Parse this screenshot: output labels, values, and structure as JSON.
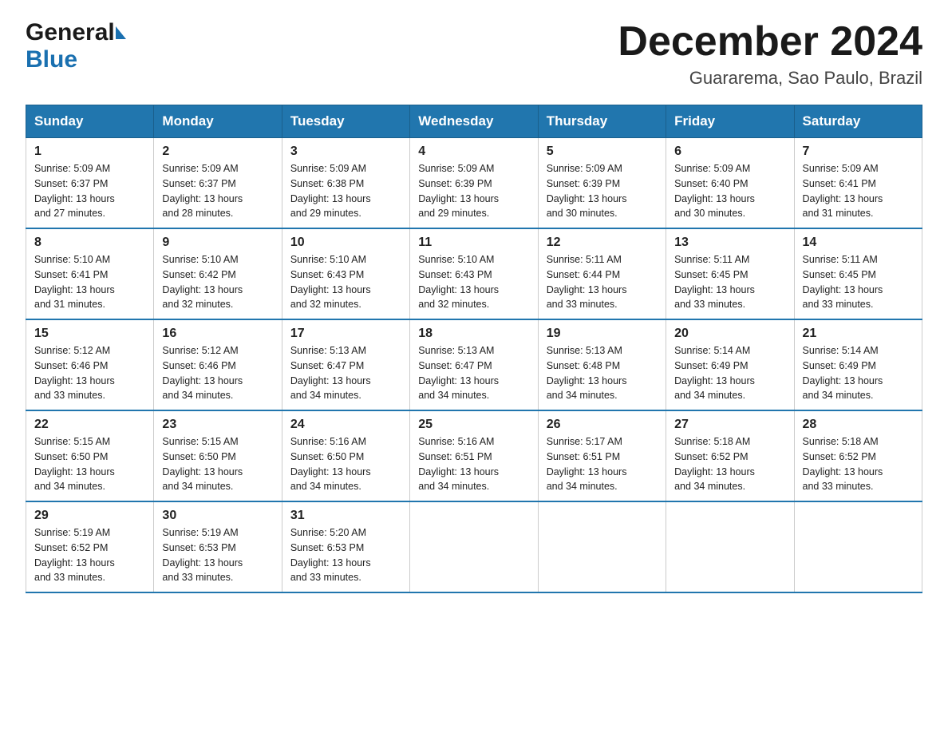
{
  "logo": {
    "general": "General",
    "blue": "Blue"
  },
  "title": "December 2024",
  "location": "Guararema, Sao Paulo, Brazil",
  "days_of_week": [
    "Sunday",
    "Monday",
    "Tuesday",
    "Wednesday",
    "Thursday",
    "Friday",
    "Saturday"
  ],
  "weeks": [
    [
      {
        "day": "1",
        "sunrise": "5:09 AM",
        "sunset": "6:37 PM",
        "daylight": "13 hours and 27 minutes."
      },
      {
        "day": "2",
        "sunrise": "5:09 AM",
        "sunset": "6:37 PM",
        "daylight": "13 hours and 28 minutes."
      },
      {
        "day": "3",
        "sunrise": "5:09 AM",
        "sunset": "6:38 PM",
        "daylight": "13 hours and 29 minutes."
      },
      {
        "day": "4",
        "sunrise": "5:09 AM",
        "sunset": "6:39 PM",
        "daylight": "13 hours and 29 minutes."
      },
      {
        "day": "5",
        "sunrise": "5:09 AM",
        "sunset": "6:39 PM",
        "daylight": "13 hours and 30 minutes."
      },
      {
        "day": "6",
        "sunrise": "5:09 AM",
        "sunset": "6:40 PM",
        "daylight": "13 hours and 30 minutes."
      },
      {
        "day": "7",
        "sunrise": "5:09 AM",
        "sunset": "6:41 PM",
        "daylight": "13 hours and 31 minutes."
      }
    ],
    [
      {
        "day": "8",
        "sunrise": "5:10 AM",
        "sunset": "6:41 PM",
        "daylight": "13 hours and 31 minutes."
      },
      {
        "day": "9",
        "sunrise": "5:10 AM",
        "sunset": "6:42 PM",
        "daylight": "13 hours and 32 minutes."
      },
      {
        "day": "10",
        "sunrise": "5:10 AM",
        "sunset": "6:43 PM",
        "daylight": "13 hours and 32 minutes."
      },
      {
        "day": "11",
        "sunrise": "5:10 AM",
        "sunset": "6:43 PM",
        "daylight": "13 hours and 32 minutes."
      },
      {
        "day": "12",
        "sunrise": "5:11 AM",
        "sunset": "6:44 PM",
        "daylight": "13 hours and 33 minutes."
      },
      {
        "day": "13",
        "sunrise": "5:11 AM",
        "sunset": "6:45 PM",
        "daylight": "13 hours and 33 minutes."
      },
      {
        "day": "14",
        "sunrise": "5:11 AM",
        "sunset": "6:45 PM",
        "daylight": "13 hours and 33 minutes."
      }
    ],
    [
      {
        "day": "15",
        "sunrise": "5:12 AM",
        "sunset": "6:46 PM",
        "daylight": "13 hours and 33 minutes."
      },
      {
        "day": "16",
        "sunrise": "5:12 AM",
        "sunset": "6:46 PM",
        "daylight": "13 hours and 34 minutes."
      },
      {
        "day": "17",
        "sunrise": "5:13 AM",
        "sunset": "6:47 PM",
        "daylight": "13 hours and 34 minutes."
      },
      {
        "day": "18",
        "sunrise": "5:13 AM",
        "sunset": "6:47 PM",
        "daylight": "13 hours and 34 minutes."
      },
      {
        "day": "19",
        "sunrise": "5:13 AM",
        "sunset": "6:48 PM",
        "daylight": "13 hours and 34 minutes."
      },
      {
        "day": "20",
        "sunrise": "5:14 AM",
        "sunset": "6:49 PM",
        "daylight": "13 hours and 34 minutes."
      },
      {
        "day": "21",
        "sunrise": "5:14 AM",
        "sunset": "6:49 PM",
        "daylight": "13 hours and 34 minutes."
      }
    ],
    [
      {
        "day": "22",
        "sunrise": "5:15 AM",
        "sunset": "6:50 PM",
        "daylight": "13 hours and 34 minutes."
      },
      {
        "day": "23",
        "sunrise": "5:15 AM",
        "sunset": "6:50 PM",
        "daylight": "13 hours and 34 minutes."
      },
      {
        "day": "24",
        "sunrise": "5:16 AM",
        "sunset": "6:50 PM",
        "daylight": "13 hours and 34 minutes."
      },
      {
        "day": "25",
        "sunrise": "5:16 AM",
        "sunset": "6:51 PM",
        "daylight": "13 hours and 34 minutes."
      },
      {
        "day": "26",
        "sunrise": "5:17 AM",
        "sunset": "6:51 PM",
        "daylight": "13 hours and 34 minutes."
      },
      {
        "day": "27",
        "sunrise": "5:18 AM",
        "sunset": "6:52 PM",
        "daylight": "13 hours and 34 minutes."
      },
      {
        "day": "28",
        "sunrise": "5:18 AM",
        "sunset": "6:52 PM",
        "daylight": "13 hours and 33 minutes."
      }
    ],
    [
      {
        "day": "29",
        "sunrise": "5:19 AM",
        "sunset": "6:52 PM",
        "daylight": "13 hours and 33 minutes."
      },
      {
        "day": "30",
        "sunrise": "5:19 AM",
        "sunset": "6:53 PM",
        "daylight": "13 hours and 33 minutes."
      },
      {
        "day": "31",
        "sunrise": "5:20 AM",
        "sunset": "6:53 PM",
        "daylight": "13 hours and 33 minutes."
      },
      null,
      null,
      null,
      null
    ]
  ],
  "labels": {
    "sunrise": "Sunrise:",
    "sunset": "Sunset:",
    "daylight": "Daylight:"
  }
}
